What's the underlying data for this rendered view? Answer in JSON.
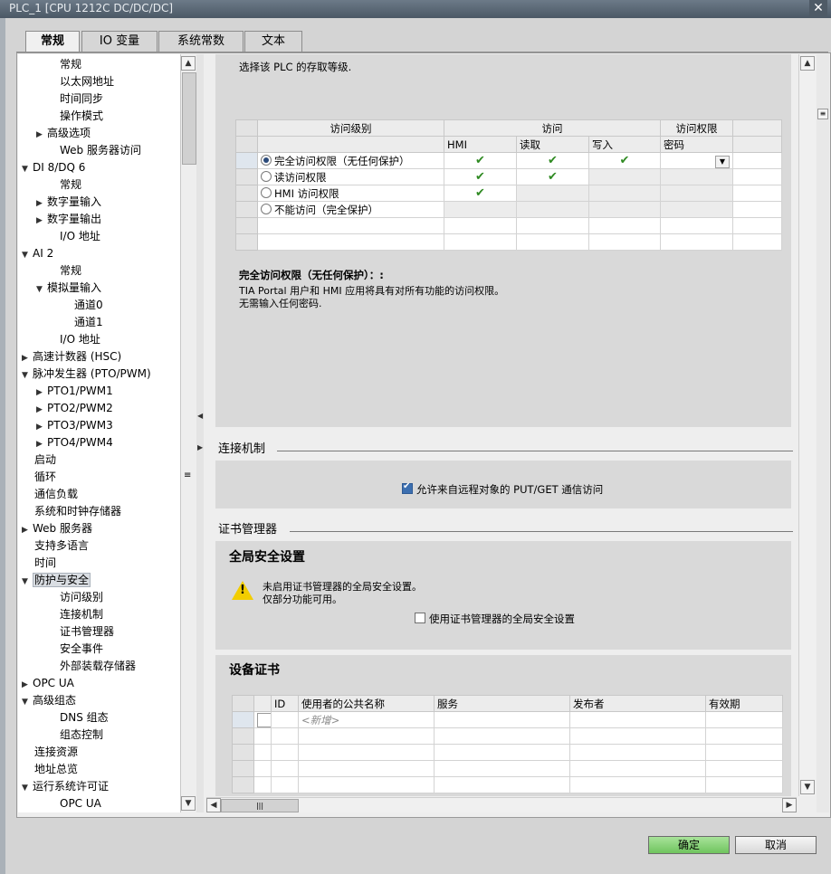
{
  "window": {
    "title": "PLC_1 [CPU 1212C DC/DC/DC]",
    "close": "✕"
  },
  "tabs": [
    "常规",
    "IO 变量",
    "系统常数",
    "文本"
  ],
  "tree": [
    {
      "label": "常规",
      "level": 2,
      "arrow": ""
    },
    {
      "label": "以太网地址",
      "level": 2,
      "arrow": ""
    },
    {
      "label": "时间同步",
      "level": 2,
      "arrow": ""
    },
    {
      "label": "操作模式",
      "level": 2,
      "arrow": ""
    },
    {
      "label": "高级选项",
      "level": 1,
      "arrow": "▶"
    },
    {
      "label": "Web 服务器访问",
      "level": 2,
      "arrow": ""
    },
    {
      "label": "DI 8/DQ 6",
      "level": 0,
      "arrow": "▼"
    },
    {
      "label": "常规",
      "level": 2,
      "arrow": ""
    },
    {
      "label": "数字量输入",
      "level": 1,
      "arrow": "▶"
    },
    {
      "label": "数字量输出",
      "level": 1,
      "arrow": "▶"
    },
    {
      "label": "I/O 地址",
      "level": 2,
      "arrow": ""
    },
    {
      "label": "AI 2",
      "level": 0,
      "arrow": "▼"
    },
    {
      "label": "常规",
      "level": 2,
      "arrow": ""
    },
    {
      "label": "模拟量输入",
      "level": 1,
      "arrow": "▼"
    },
    {
      "label": "通道0",
      "level": 3,
      "arrow": ""
    },
    {
      "label": "通道1",
      "level": 3,
      "arrow": ""
    },
    {
      "label": "I/O 地址",
      "level": 2,
      "arrow": ""
    },
    {
      "label": "高速计数器 (HSC)",
      "level": 0,
      "arrow": "▶"
    },
    {
      "label": "脉冲发生器 (PTO/PWM)",
      "level": 0,
      "arrow": "▼"
    },
    {
      "label": "PTO1/PWM1",
      "level": 1,
      "arrow": "▶"
    },
    {
      "label": "PTO2/PWM2",
      "level": 1,
      "arrow": "▶"
    },
    {
      "label": "PTO3/PWM3",
      "level": 1,
      "arrow": "▶"
    },
    {
      "label": "PTO4/PWM4",
      "level": 1,
      "arrow": "▶"
    },
    {
      "label": "启动",
      "level": 0.5,
      "arrow": ""
    },
    {
      "label": "循环",
      "level": 0.5,
      "arrow": ""
    },
    {
      "label": "通信负载",
      "level": 0.5,
      "arrow": ""
    },
    {
      "label": "系统和时钟存储器",
      "level": 0.5,
      "arrow": ""
    },
    {
      "label": "Web 服务器",
      "level": 0,
      "arrow": "▶"
    },
    {
      "label": "支持多语言",
      "level": 0.5,
      "arrow": ""
    },
    {
      "label": "时间",
      "level": 0.5,
      "arrow": ""
    },
    {
      "label": "防护与安全",
      "level": 0,
      "arrow": "▼",
      "selected": true
    },
    {
      "label": "访问级别",
      "level": 2,
      "arrow": ""
    },
    {
      "label": "连接机制",
      "level": 2,
      "arrow": ""
    },
    {
      "label": "证书管理器",
      "level": 2,
      "arrow": ""
    },
    {
      "label": "安全事件",
      "level": 2,
      "arrow": ""
    },
    {
      "label": "外部装载存储器",
      "level": 2,
      "arrow": ""
    },
    {
      "label": "OPC UA",
      "level": 0,
      "arrow": "▶"
    },
    {
      "label": "高级组态",
      "level": 0,
      "arrow": "▼"
    },
    {
      "label": "DNS 组态",
      "level": 2,
      "arrow": ""
    },
    {
      "label": "组态控制",
      "level": 2,
      "arrow": ""
    },
    {
      "label": "连接资源",
      "level": 0.5,
      "arrow": ""
    },
    {
      "label": "地址总览",
      "level": 0.5,
      "arrow": ""
    },
    {
      "label": "运行系统许可证",
      "level": 0,
      "arrow": "▼"
    },
    {
      "label": "OPC UA",
      "level": 2,
      "arrow": ""
    }
  ],
  "access": {
    "intro": "选择该 PLC 的存取等级.",
    "headers": {
      "level": "访问级别",
      "access": "访问",
      "perm": "访问权限"
    },
    "subheaders": {
      "hmi": "HMI",
      "read": "读取",
      "write": "写入",
      "password": "密码"
    },
    "rows": [
      {
        "label": "完全访问权限（无任何保护）",
        "selected": true,
        "hmi": "✔",
        "read": "✔",
        "write": "✔"
      },
      {
        "label": "读访问权限",
        "selected": false,
        "hmi": "✔",
        "read": "✔",
        "write": ""
      },
      {
        "label": "HMI 访问权限",
        "selected": false,
        "hmi": "✔",
        "read": "",
        "write": ""
      },
      {
        "label": "不能访问（完全保护）",
        "selected": false,
        "hmi": "",
        "read": "",
        "write": ""
      }
    ],
    "desc_title": "完全访问权限（无任何保护）：:",
    "desc_line1": "TIA Portal 用户和 HMI 应用将具有对所有功能的访问权限。",
    "desc_line2": "无需输入任何密码."
  },
  "connection": {
    "title": "连接机制",
    "checkbox_label": "允许来自远程对象的 PUT/GET 通信访问",
    "checked": true
  },
  "cert": {
    "title": "证书管理器",
    "global_title": "全局安全设置",
    "warn_line1": "未启用证书管理器的全局安全设置。",
    "warn_line2": "仅部分功能可用。",
    "checkbox_label": "使用证书管理器的全局安全设置",
    "checked": false,
    "device_title": "设备证书",
    "cols": [
      "ID",
      "使用者的公共名称",
      "服务",
      "发布者",
      "有效期"
    ],
    "new_row": "<新增>"
  },
  "buttons": {
    "ok": "确定",
    "cancel": "取消"
  },
  "colors": {
    "ok_button": "#7fcf6c",
    "check": "#2f8a22",
    "warning": "#f2cd00"
  }
}
